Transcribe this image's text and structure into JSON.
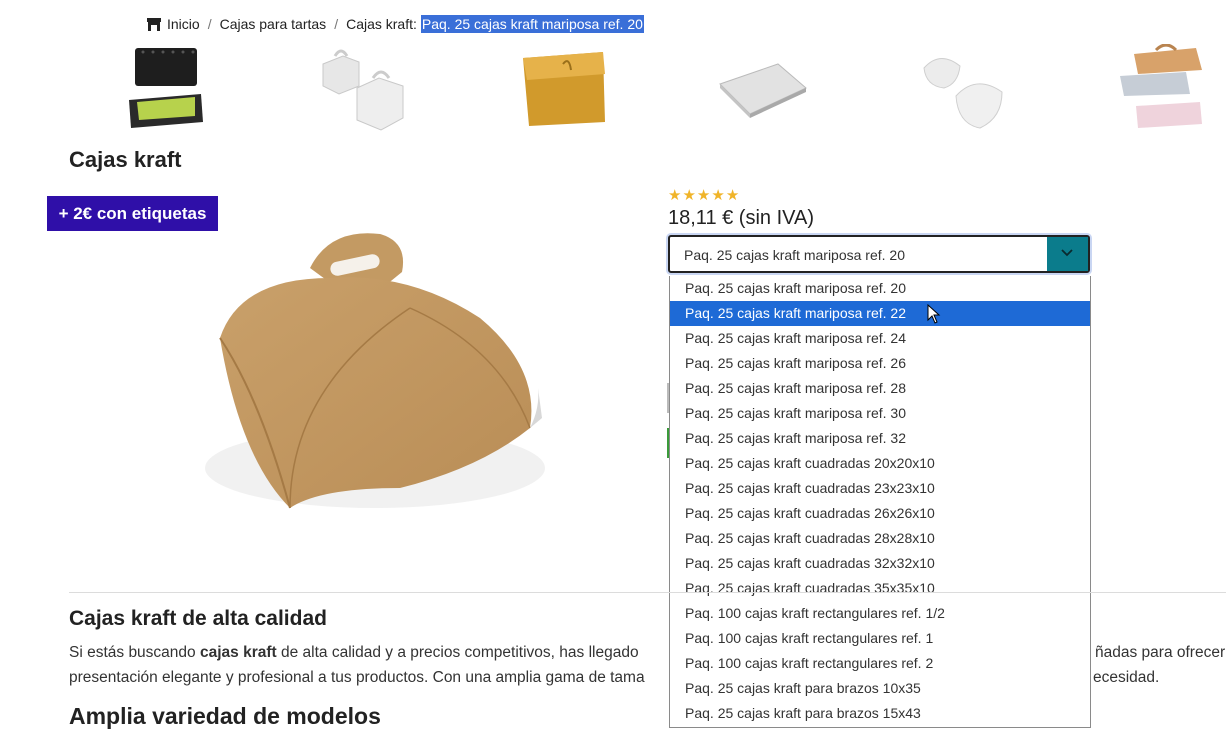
{
  "breadcrumb": {
    "home": "Inicio",
    "separator": "/",
    "category": "Cajas para tartas",
    "subcategory": "Cajas kraft:",
    "current": "Paq. 25 cajas kraft mariposa ref. 20"
  },
  "thumbnails": [
    {
      "icon": "black-tray-box"
    },
    {
      "icon": "white-handle-boxes"
    },
    {
      "icon": "gold-box"
    },
    {
      "icon": "silver-tray"
    },
    {
      "icon": "white-butterfly-boxes"
    },
    {
      "icon": "handle-tube-boxes"
    }
  ],
  "section_title": "Cajas kraft",
  "promo_badge": "+ 2€ con etiquetas",
  "product": {
    "rating_stars": 5,
    "price": "18,11 € (sin IVA)"
  },
  "select": {
    "value": "Paq. 25 cajas kraft mariposa ref. 20",
    "options": [
      "Paq. 25 cajas kraft mariposa ref. 20",
      "Paq. 25 cajas kraft mariposa ref. 22",
      "Paq. 25 cajas kraft mariposa ref. 24",
      "Paq. 25 cajas kraft mariposa ref. 26",
      "Paq. 25 cajas kraft mariposa ref. 28",
      "Paq. 25 cajas kraft mariposa ref. 30",
      "Paq. 25 cajas kraft mariposa ref. 32",
      "Paq. 25 cajas kraft cuadradas 20x20x10",
      "Paq. 25 cajas kraft cuadradas 23x23x10",
      "Paq. 25 cajas kraft cuadradas 26x26x10",
      "Paq. 25 cajas kraft cuadradas 28x28x10",
      "Paq. 25 cajas kraft cuadradas 32x32x10",
      "Paq. 25 cajas kraft cuadradas 35x35x10",
      "Paq. 100 cajas kraft rectangulares ref. 1/2",
      "Paq. 100 cajas kraft rectangulares ref. 1",
      "Paq. 100 cajas kraft rectangulares ref. 2",
      "Paq. 25 cajas kraft para brazos 10x35",
      "Paq. 25 cajas kraft para brazos 15x43"
    ],
    "highlighted_index": 1
  },
  "description": {
    "heading": "Cajas kraft de alta calidad",
    "line1_pre": "Si estás buscando ",
    "line1_bold": "cajas kraft",
    "line1_post": " de alta calidad y a precios competitivos, has llegado",
    "line1_right": "ñadas para ofrecer",
    "line2_left": "presentación elegante y profesional a tus productos. Con una amplia gama de tama",
    "line2_right": "ecesidad.",
    "models_heading": "Amplia variedad de modelos"
  },
  "colors": {
    "select_arrow_bg": "#0b7c8c",
    "option_highlight": "#1e6ad6",
    "promo_bg": "#2f0fa8",
    "star": "#f0b429"
  }
}
